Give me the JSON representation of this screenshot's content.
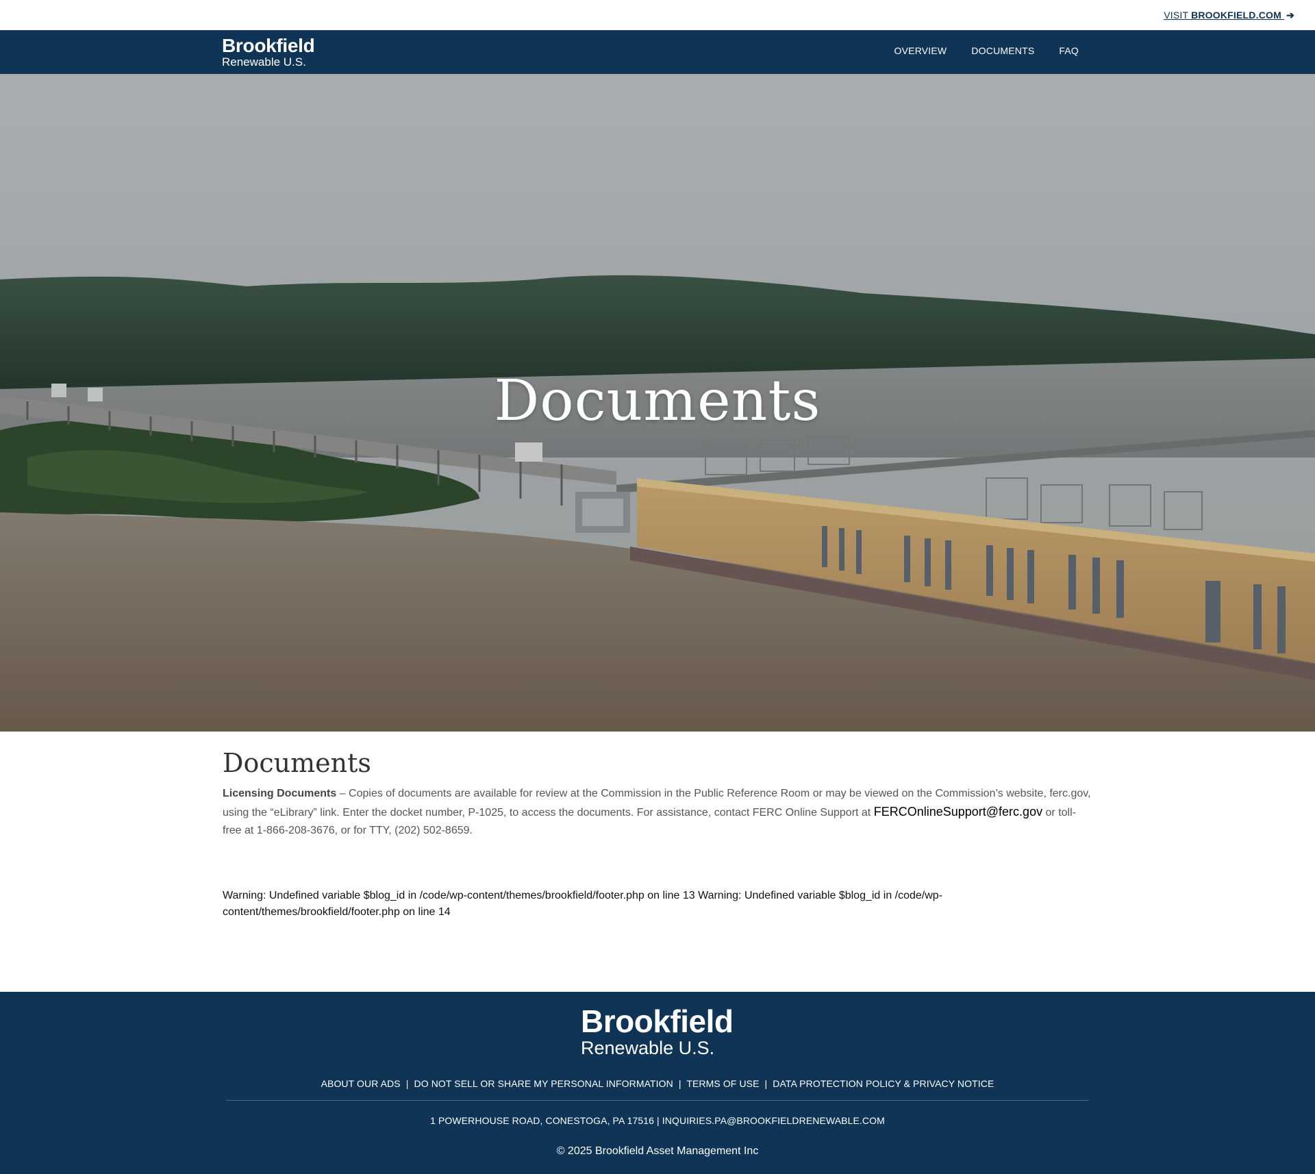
{
  "utility": {
    "visit_prefix": "VISIT",
    "visit_site": "BROOKFIELD.COM",
    "arrow": "➔"
  },
  "brand": {
    "name": "Brookfield",
    "subname": "Renewable U.S."
  },
  "nav": {
    "items": [
      {
        "label": "OVERVIEW"
      },
      {
        "label": "DOCUMENTS"
      },
      {
        "label": "FAQ"
      }
    ]
  },
  "hero": {
    "title": "Documents"
  },
  "content": {
    "heading": "Documents",
    "lead_bold": "Licensing Documents",
    "body_text": " – Copies of documents are available for review at the Commission in the Public Reference Room or may be viewed on the Commission’s website, ferc.gov, using the “eLibrary” link. Enter the docket number, P-1025, to access the documents. For assistance, contact FERC Online Support at ",
    "email": "FERCOnlineSupport@ferc.gov",
    "body_tail": " or toll-free at 1-866-208-3676, or for TTY, (202) 502-8659."
  },
  "warning": {
    "text": "Warning: Undefined variable $blog_id in /code/wp-content/themes/brookfield/footer.php on line 13 Warning: Undefined variable $blog_id in /code/wp-content/themes/brookfield/footer.php on line 14"
  },
  "footer": {
    "links": [
      {
        "label": "ABOUT OUR ADS"
      },
      {
        "label": "DO NOT SELL OR SHARE MY PERSONAL INFORMATION"
      },
      {
        "label": "TERMS OF USE"
      },
      {
        "label": "DATA PROTECTION POLICY & PRIVACY NOTICE"
      }
    ],
    "separator": "|",
    "address": "1 POWERHOUSE ROAD, CONESTOGA, PA 17516",
    "email": "INQUIRIES.PA@BROOKFIELDRENEWABLE.COM",
    "copyright": "© 2025 Brookfield Asset Management Inc"
  },
  "colors": {
    "navy": "#0f3456",
    "white": "#ffffff"
  }
}
